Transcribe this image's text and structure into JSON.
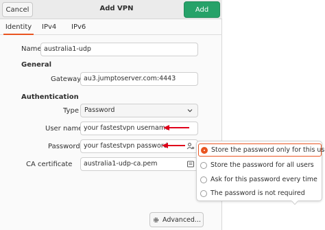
{
  "header": {
    "cancel_label": "Cancel",
    "title": "Add VPN",
    "add_label": "Add",
    "add_color": "#26a269"
  },
  "tabs": [
    {
      "label": "Identity",
      "active": true
    },
    {
      "label": "IPv4",
      "active": false
    },
    {
      "label": "IPv6",
      "active": false
    }
  ],
  "identity": {
    "name_label": "Name",
    "name_value": "australia1-udp",
    "general_heading": "General",
    "gateway_label": "Gateway",
    "gateway_value": "au3.jumptoserver.com:4443",
    "auth_heading": "Authentication",
    "type_label": "Type",
    "type_value": "Password",
    "username_label": "User name",
    "username_value": "your fastestvpn username",
    "password_label": "Password",
    "password_value": "your fastestvpn password",
    "ca_label": "CA certificate",
    "ca_value": "australia1-udp-ca.pem",
    "advanced_label": "Advanced..."
  },
  "password_options": {
    "items": [
      {
        "label": "Store the password only for this user",
        "selected": true
      },
      {
        "label": "Store the password for all users",
        "selected": false
      },
      {
        "label": "Ask for this password every time",
        "selected": false
      },
      {
        "label": "The password is not required",
        "selected": false
      }
    ]
  },
  "colors": {
    "accent": "#e95420",
    "annotation_arrow": "#e0001a"
  },
  "icons": {
    "type_dropdown": "chevron-down-icon",
    "password_storage": "user-key-icon",
    "ca_file": "file-chooser-icon",
    "advanced": "gear-icon"
  }
}
